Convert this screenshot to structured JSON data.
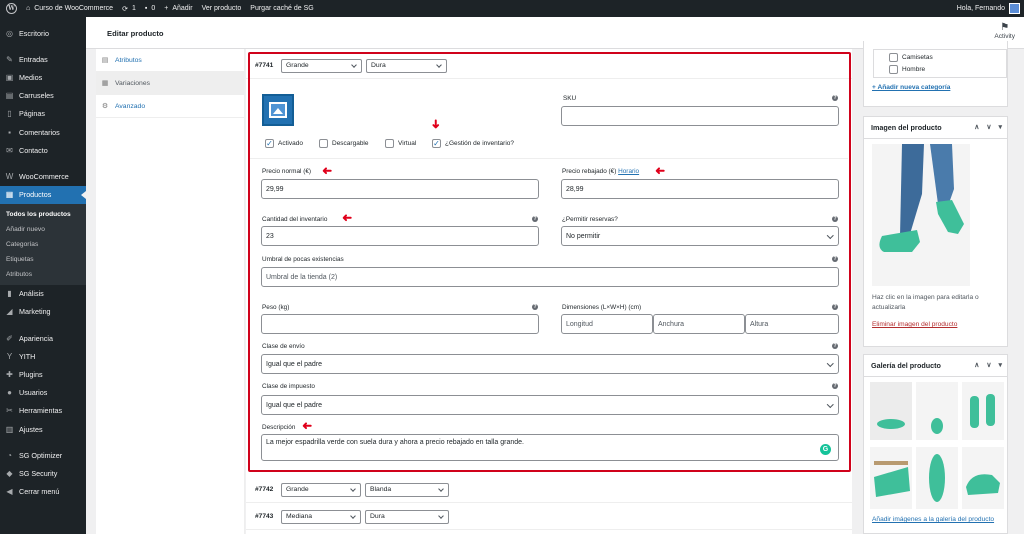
{
  "adminbar": {
    "site_name": "Curso de WooCommerce",
    "updates": "1",
    "comments": "0",
    "add_new": "Añadir",
    "view_product": "Ver producto",
    "purge_cache": "Purgar caché de SG",
    "greeting": "Hola, Fernando"
  },
  "sidebar": {
    "items": [
      {
        "label": "Escritorio",
        "icon": "dashboard-icon"
      },
      {
        "label": "Entradas",
        "icon": "pin-icon"
      },
      {
        "label": "Medios",
        "icon": "media-icon"
      },
      {
        "label": "Carruseles",
        "icon": "carousel-icon"
      },
      {
        "label": "Páginas",
        "icon": "page-icon"
      },
      {
        "label": "Comentarios",
        "icon": "comment-icon"
      },
      {
        "label": "Contacto",
        "icon": "mail-icon"
      },
      {
        "label": "WooCommerce",
        "icon": "woo-icon"
      },
      {
        "label": "Productos",
        "icon": "archive-icon"
      }
    ],
    "submenu": [
      "Todos los productos",
      "Añadir nuevo",
      "Categorías",
      "Etiquetas",
      "Atributos"
    ],
    "items2": [
      {
        "label": "Análisis",
        "icon": "chart-icon"
      },
      {
        "label": "Marketing",
        "icon": "megaphone-icon"
      },
      {
        "label": "Apariencia",
        "icon": "brush-icon"
      },
      {
        "label": "YITH",
        "icon": "yith-icon"
      },
      {
        "label": "Plugins",
        "icon": "plugin-icon"
      },
      {
        "label": "Usuarios",
        "icon": "users-icon"
      },
      {
        "label": "Herramientas",
        "icon": "tools-icon"
      },
      {
        "label": "Ajustes",
        "icon": "settings-icon"
      },
      {
        "label": "SG Optimizer",
        "icon": "sg-icon"
      },
      {
        "label": "SG Security",
        "icon": "shield-icon"
      },
      {
        "label": "Cerrar menú",
        "icon": "collapse-icon"
      }
    ]
  },
  "header": {
    "title": "Editar producto",
    "activity": "Activity"
  },
  "tabs": [
    "Atributos",
    "Variaciones",
    "Avanzado"
  ],
  "variations": [
    {
      "id": "#7741",
      "size": "Grande",
      "sole": "Dura"
    },
    {
      "id": "#7742",
      "size": "Grande",
      "sole": "Blanda"
    },
    {
      "id": "#7743",
      "size": "Mediana",
      "sole": "Dura"
    }
  ],
  "form": {
    "sku_label": "SKU",
    "sku_value": "",
    "checkboxes": [
      {
        "label": "Activado",
        "checked": true
      },
      {
        "label": "Descargable",
        "checked": false
      },
      {
        "label": "Virtual",
        "checked": false
      },
      {
        "label": "¿Gestión de inventario?",
        "checked": true
      }
    ],
    "regular_price_label": "Precio normal (€)",
    "regular_price": "29,99",
    "sale_price_label": "Precio rebajado (€)",
    "sale_schedule_link": "Horario",
    "sale_price": "28,99",
    "stock_label": "Cantidad del inventario",
    "stock_value": "23",
    "backorders_label": "¿Permitir reservas?",
    "backorders_value": "No permitir",
    "low_stock_label": "Umbral de pocas existencias",
    "low_stock_placeholder": "Umbral de la tienda (2)",
    "weight_label": "Peso (kg)",
    "dimensions_label": "Dimensiones (L×W×H) (cm)",
    "length_placeholder": "Longitud",
    "width_placeholder": "Anchura",
    "height_placeholder": "Altura",
    "shipping_label": "Clase de envío",
    "shipping_value": "Igual que el padre",
    "tax_label": "Clase de impuesto",
    "tax_value": "Igual que el padre",
    "description_label": "Descripción",
    "description_value": "La mejor espadrilla verde con suela dura y ahora a precio rebajado en talla grande."
  },
  "categories": {
    "items": [
      "Camisetas",
      "Hombre"
    ],
    "add_link": "+ Añadir nueva categoría"
  },
  "product_image": {
    "title": "Imagen del producto",
    "hint": "Haz clic en la imagen para editarla o actualizarla",
    "remove_link": "Eliminar imagen del producto"
  },
  "gallery": {
    "title": "Galería del producto",
    "add_link": "Añadir imágenes a la galería del producto"
  },
  "colors": {
    "accent": "#2271b1",
    "highlight": "#d0021b",
    "shoe": "#3fbf9a"
  }
}
